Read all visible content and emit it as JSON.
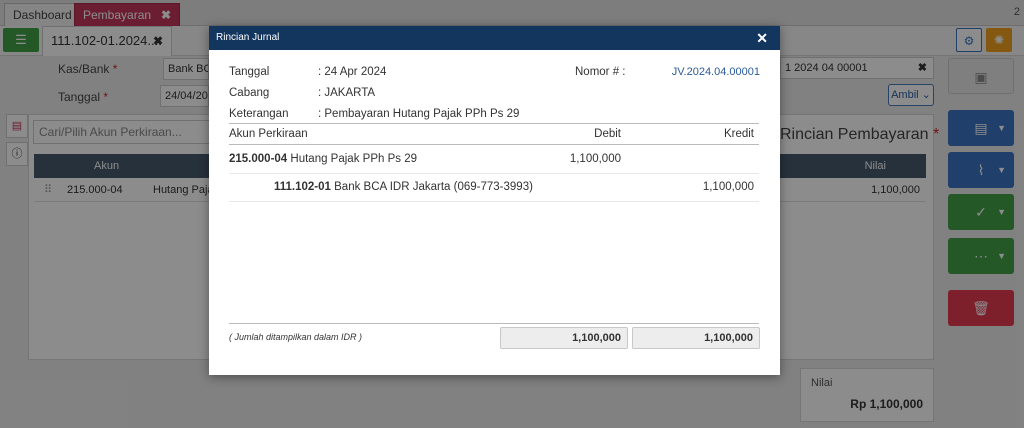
{
  "top_tabs": [
    {
      "label": "Dashboard"
    },
    {
      "label": "Pembayaran",
      "close": "✖"
    }
  ],
  "top_count": "2",
  "doc_tab": {
    "label": "111.102-01.2024....",
    "close": "✖"
  },
  "form": {
    "kas_bank_label": "Kas/Bank",
    "kas_bank_value": "Bank BCA",
    "tanggal_label": "Tanggal",
    "tanggal_value": "24/04/202",
    "required_mark": "*",
    "right_field_value": "1 2024 04 00001",
    "right_field_clear": "✖",
    "ambil_label": "Ambil",
    "search_placeholder": "Cari/Pilih Akun Perkiraan...",
    "rincian_title": "Rincian Pembayaran",
    "table_headers": {
      "akun": "Akun",
      "nilai": "Nilai"
    },
    "row": {
      "akun": "215.000-04",
      "nama": "Hutang Paja",
      "nilai": "1,100,000"
    },
    "nilai_label": "Nilai",
    "nilai_total": "Rp 1,100,000"
  },
  "modal": {
    "title": "Rincian Jurnal",
    "close": "✕",
    "tanggal_label": "Tanggal",
    "tanggal_value": ": 24 Apr 2024",
    "cabang_label": "Cabang",
    "cabang_value": ": JAKARTA",
    "keterangan_label": "Keterangan",
    "keterangan_value": ": Pembayaran Hutang Pajak PPh Ps 29",
    "nomor_label": "Nomor # :",
    "nomor_value": "JV.2024.04.00001",
    "columns": {
      "akun": "Akun Perkiraan",
      "debit": "Debit",
      "kredit": "Kredit"
    },
    "rows": [
      {
        "code": "215.000-04",
        "name": "Hutang Pajak PPh Ps 29",
        "debit": "1,100,000",
        "kredit": ""
      },
      {
        "code": "111.102-01",
        "name": "Bank BCA IDR Jakarta (069-773-3993)",
        "debit": "",
        "kredit": "1,100,000"
      }
    ],
    "note": "( Jumlah ditampilkan dalam IDR )",
    "total_debit": "1,100,000",
    "total_kredit": "1,100,000"
  },
  "colors": {
    "modal_header": "#12365e",
    "active_tab": "#c4385b",
    "action_blue": "#3b74c4",
    "action_green": "#43a047",
    "action_red": "#e53950"
  }
}
